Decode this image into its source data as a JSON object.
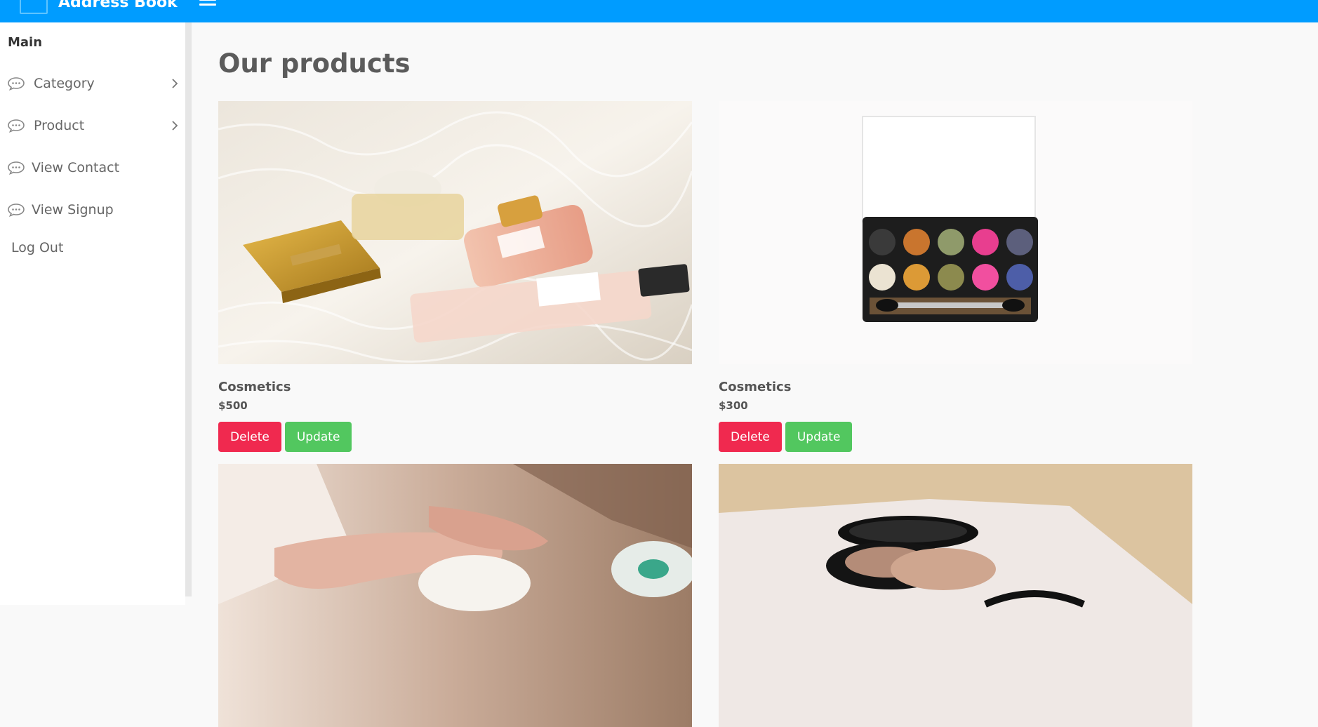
{
  "topbar": {
    "brand": "Address Book"
  },
  "sidebar": {
    "heading": "Main",
    "items": [
      {
        "label": "Category",
        "has_submenu": true
      },
      {
        "label": "Product",
        "has_submenu": true
      },
      {
        "label": "View Contact",
        "has_submenu": false
      },
      {
        "label": "View Signup",
        "has_submenu": false
      }
    ],
    "logout": "Log Out"
  },
  "main": {
    "title": "Our products",
    "products": [
      {
        "name": "Cosmetics",
        "price": "$500",
        "delete_label": "Delete",
        "update_label": "Update"
      },
      {
        "name": "Cosmetics",
        "price": "$300",
        "delete_label": "Delete",
        "update_label": "Update"
      },
      {
        "name": "",
        "price": ""
      },
      {
        "name": "",
        "price": ""
      }
    ]
  },
  "colors": {
    "topbar": "#009cff",
    "delete_button": "#f0294f",
    "update_button": "#52c75f"
  }
}
